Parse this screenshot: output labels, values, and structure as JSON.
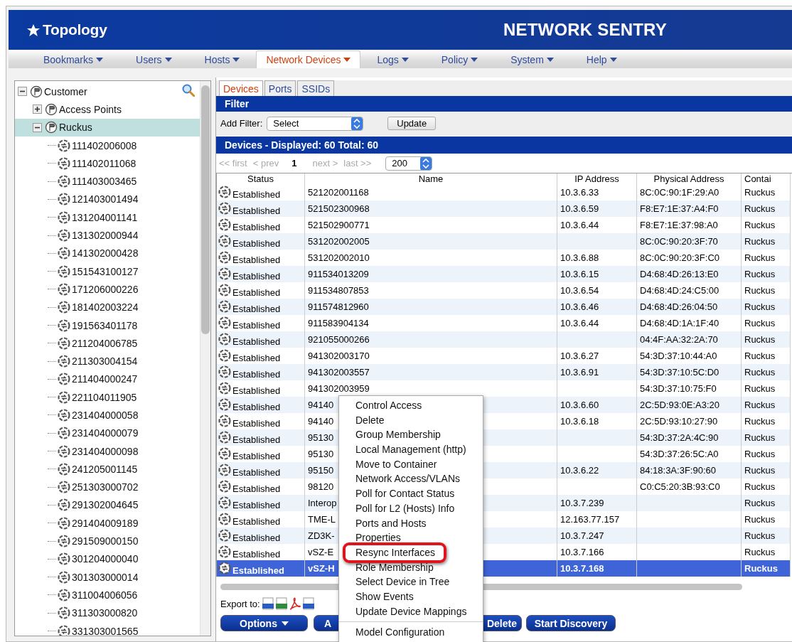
{
  "header": {
    "title": "Topology",
    "product": "NETWORK SENTRY"
  },
  "nav": [
    {
      "label": "Bookmarks",
      "selected": false
    },
    {
      "label": "Users",
      "selected": false
    },
    {
      "label": "Hosts",
      "selected": false
    },
    {
      "label": "Network Devices",
      "selected": true
    },
    {
      "label": "Logs",
      "selected": false
    },
    {
      "label": "Policy",
      "selected": false
    },
    {
      "label": "System",
      "selected": false
    },
    {
      "label": "Help",
      "selected": false
    }
  ],
  "tree": [
    {
      "label": "Customer",
      "kind": "folder",
      "expanded": true,
      "selected": false,
      "children": [
        {
          "label": "Access Points",
          "kind": "folder",
          "expanded": false,
          "selected": false
        },
        {
          "label": "Ruckus",
          "kind": "folder",
          "expanded": true,
          "selected": true,
          "children": [
            {
              "label": "111402006008",
              "kind": "device",
              "selected": false
            },
            {
              "label": "111402011068",
              "kind": "device",
              "selected": false
            },
            {
              "label": "111403003465",
              "kind": "device",
              "selected": false
            },
            {
              "label": "121403001494",
              "kind": "device",
              "selected": false
            },
            {
              "label": "131204001141",
              "kind": "device",
              "selected": false
            },
            {
              "label": "131302000944",
              "kind": "device",
              "selected": false
            },
            {
              "label": "141302000428",
              "kind": "device",
              "selected": false
            },
            {
              "label": "151543100127",
              "kind": "device",
              "selected": false
            },
            {
              "label": "171206000226",
              "kind": "device",
              "selected": false
            },
            {
              "label": "181402003224",
              "kind": "device",
              "selected": false
            },
            {
              "label": "191563401178",
              "kind": "device",
              "selected": false
            },
            {
              "label": "211204006785",
              "kind": "device",
              "selected": false
            },
            {
              "label": "211303004154",
              "kind": "device",
              "selected": false
            },
            {
              "label": "211404000247",
              "kind": "device",
              "selected": false
            },
            {
              "label": "221104011905",
              "kind": "device",
              "selected": false
            },
            {
              "label": "231404000058",
              "kind": "device",
              "selected": false
            },
            {
              "label": "231404000079",
              "kind": "device",
              "selected": false
            },
            {
              "label": "231404000098",
              "kind": "device",
              "selected": false
            },
            {
              "label": "241205001145",
              "kind": "device",
              "selected": false
            },
            {
              "label": "251303000702",
              "kind": "device",
              "selected": false
            },
            {
              "label": "291302004645",
              "kind": "device",
              "selected": false
            },
            {
              "label": "291404009189",
              "kind": "device",
              "selected": false
            },
            {
              "label": "291509000150",
              "kind": "device",
              "selected": false
            },
            {
              "label": "301204000040",
              "kind": "device",
              "selected": false
            },
            {
              "label": "301303000014",
              "kind": "device",
              "selected": false
            },
            {
              "label": "311004006056",
              "kind": "device",
              "selected": false
            },
            {
              "label": "311303000820",
              "kind": "device",
              "selected": false
            },
            {
              "label": "331303001565",
              "kind": "device",
              "selected": false
            }
          ]
        }
      ]
    }
  ],
  "tabs": [
    {
      "label": "Devices",
      "selected": true
    },
    {
      "label": "Ports",
      "selected": false
    },
    {
      "label": "SSIDs",
      "selected": false
    }
  ],
  "filter": {
    "title": "Filter",
    "label": "Add Filter:",
    "select": "Select",
    "button": "Update"
  },
  "devices_title": "Devices - Displayed: 60 Total: 60",
  "pager": {
    "first": "<< first",
    "prev": "< prev",
    "page": "1",
    "next": "next >",
    "last": "last >>",
    "page_size": "200"
  },
  "table": {
    "columns": [
      "Status",
      "Name",
      "IP Address",
      "Physical Address",
      "Contai"
    ],
    "rows": [
      {
        "status": "Established",
        "name": "521202001168",
        "ip": "10.3.6.33",
        "mac": "8C:0C:90:1F:29:A0",
        "container": "Ruckus",
        "selected": false
      },
      {
        "status": "Established",
        "name": "521502300968",
        "ip": "10.3.6.59",
        "mac": "F8:E7:1E:37:A4:F0",
        "container": "Ruckus",
        "selected": false
      },
      {
        "status": "Established",
        "name": "521502900771",
        "ip": "10.3.6.44",
        "mac": "F8:E7:1E:37:98:A0",
        "container": "Ruckus",
        "selected": false
      },
      {
        "status": "Established",
        "name": "531202002005",
        "mac": "8C:0C:90:20:3F:70",
        "container": "Ruckus",
        "selected": false
      },
      {
        "status": "Established",
        "name": "531202002010",
        "ip": "10.3.6.88",
        "mac": "8C:0C:90:20:3F:C0",
        "container": "Ruckus",
        "selected": false
      },
      {
        "status": "Established",
        "name": "911534013209",
        "ip": "10.3.6.15",
        "mac": "D4:68:4D:26:13:E0",
        "container": "Ruckus",
        "selected": false
      },
      {
        "status": "Established",
        "name": "911534807853",
        "ip": "10.3.6.54",
        "mac": "D4:68:4D:24:C5:00",
        "container": "Ruckus",
        "selected": false
      },
      {
        "status": "Established",
        "name": "911574812960",
        "ip": "10.3.6.46",
        "mac": "D4:68:4D:26:04:50",
        "container": "Ruckus",
        "selected": false
      },
      {
        "status": "Established",
        "name": "911583904134",
        "ip": "10.3.6.44",
        "mac": "D4:68:4D:1A:1F:40",
        "container": "Ruckus",
        "selected": false
      },
      {
        "status": "Established",
        "name": "921055000266",
        "mac": "04:4F:AA:32:2A:70",
        "container": "Ruckus",
        "selected": false
      },
      {
        "status": "Established",
        "name": "941302003170",
        "ip": "10.3.6.27",
        "mac": "54:3D:37:10:44:A0",
        "container": "Ruckus",
        "selected": false
      },
      {
        "status": "Established",
        "name": "941302003557",
        "ip": "10.3.6.91",
        "mac": "54:3D:37:10:5C:D0",
        "container": "Ruckus",
        "selected": false
      },
      {
        "status": "Established",
        "name": "941302003959",
        "mac": "54:3D:37:10:75:F0",
        "container": "Ruckus",
        "selected": false
      },
      {
        "status": "Established",
        "name": "94140",
        "ip": "10.3.6.60",
        "mac": "2C:5D:93:0E:A3:20",
        "container": "Ruckus",
        "selected": false
      },
      {
        "status": "Established",
        "name": "94140",
        "ip": "10.3.6.18",
        "mac": "2C:5D:93:10:27:90",
        "container": "Ruckus",
        "selected": false
      },
      {
        "status": "Established",
        "name": "95130",
        "mac": "54:3D:37:2A:4C:90",
        "container": "Ruckus",
        "selected": false
      },
      {
        "status": "Established",
        "name": "95130",
        "mac": "54:3D:37:26:5C:A0",
        "container": "Ruckus",
        "selected": false
      },
      {
        "status": "Established",
        "name": "95150",
        "ip": "10.3.6.22",
        "mac": "84:18:3A:3F:90:60",
        "container": "Ruckus",
        "selected": false
      },
      {
        "status": "Established",
        "name": "98120",
        "mac": "C0:C5:20:3B:93:C0",
        "container": "Ruckus",
        "selected": false
      },
      {
        "status": "Established",
        "name": "Interop",
        "ip": "10.3.7.239",
        "container": "Ruckus",
        "selected": false
      },
      {
        "status": "Established",
        "name": "TME-L",
        "ip": "12.163.77.157",
        "container": "Ruckus",
        "selected": false
      },
      {
        "status": "Established",
        "name": "ZD3K-",
        "ip": "10.3.7.247",
        "container": "Ruckus",
        "selected": false
      },
      {
        "status": "Established",
        "name": "vSZ-E",
        "ip": "10.3.7.166",
        "container": "Ruckus",
        "selected": false
      },
      {
        "status": "Established",
        "name": "vSZ-H",
        "ip": "10.3.7.168",
        "container": "Ruckus",
        "selected": true
      }
    ]
  },
  "export_label": "Export to:",
  "buttons": [
    {
      "label": "Options",
      "kind": "dropdown"
    },
    {
      "label": "A",
      "kind": "plain"
    },
    {
      "label": "Delete",
      "kind": "plain"
    },
    {
      "label": "Start Discovery",
      "kind": "plain"
    }
  ],
  "context_menu": {
    "groups": [
      [
        {
          "label": "Control Access",
          "annotated": false
        },
        {
          "label": "Delete",
          "annotated": false
        },
        {
          "label": "Group Membership",
          "annotated": false
        },
        {
          "label": "Local Management (http)",
          "annotated": false
        },
        {
          "label": "Move to Container",
          "annotated": false
        },
        {
          "label": "Network Access/VLANs",
          "annotated": false
        },
        {
          "label": "Poll for Contact Status",
          "annotated": false
        },
        {
          "label": "Poll for L2 (Hosts) Info",
          "annotated": false
        },
        {
          "label": "Ports and Hosts",
          "annotated": false
        },
        {
          "label": "Properties",
          "annotated": false
        },
        {
          "label": "Resync Interfaces",
          "annotated": true
        },
        {
          "label": "Role Membership",
          "annotated": false
        },
        {
          "label": "Select Device in Tree",
          "annotated": false
        },
        {
          "label": "Show Events",
          "annotated": false
        },
        {
          "label": "Update Device Mappings",
          "annotated": false
        }
      ],
      [
        {
          "label": "Model Configuration",
          "annotated": false
        }
      ]
    ]
  }
}
